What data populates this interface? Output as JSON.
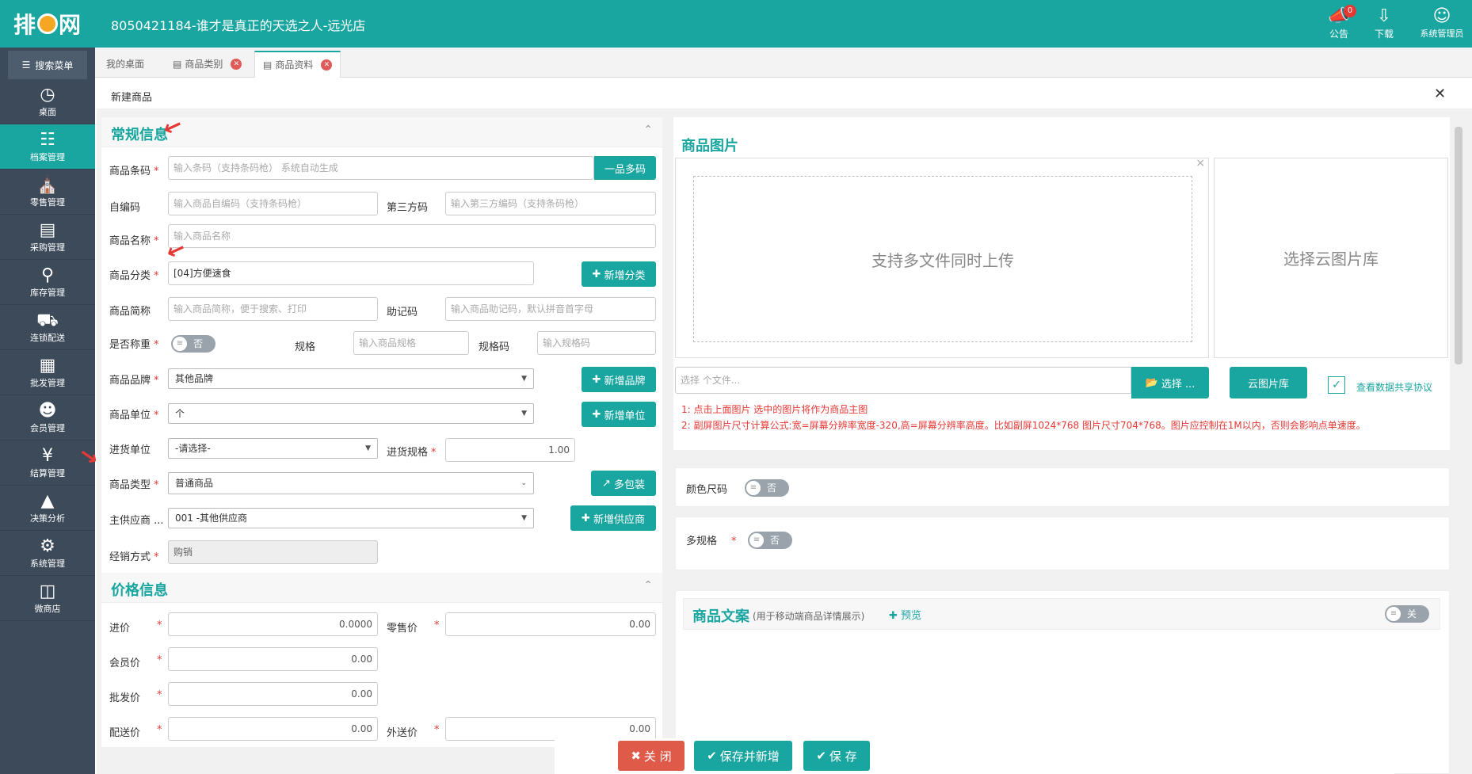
{
  "header": {
    "title": "8050421184-谁才是真正的天选之人-远光店",
    "logo": "排队网",
    "notice_label": "公告",
    "notice_count": "0",
    "download_label": "下载",
    "user_label": "系统管理员"
  },
  "sidebar": {
    "search": "搜索菜单",
    "items": [
      {
        "label": "桌面",
        "icon": "dashboard-icon"
      },
      {
        "label": "档案管理",
        "icon": "file-icon"
      },
      {
        "label": "零售管理",
        "icon": "store-icon"
      },
      {
        "label": "采购管理",
        "icon": "cart-icon"
      },
      {
        "label": "库存管理",
        "icon": "inventory-icon"
      },
      {
        "label": "连锁配送",
        "icon": "truck-icon"
      },
      {
        "label": "批发管理",
        "icon": "wholesale-icon"
      },
      {
        "label": "会员管理",
        "icon": "member-icon"
      },
      {
        "label": "结算管理",
        "icon": "settle-icon"
      },
      {
        "label": "决策分析",
        "icon": "chart-icon"
      },
      {
        "label": "系统管理",
        "icon": "gear-icon"
      },
      {
        "label": "微商店",
        "icon": "bag-icon"
      }
    ]
  },
  "tabs": [
    {
      "label": "我的桌面"
    },
    {
      "label": "商品类别"
    },
    {
      "label": "商品资料"
    }
  ],
  "dialog": {
    "title": "新建商品"
  },
  "general": {
    "title": "常规信息",
    "barcode_label": "商品条码",
    "barcode_ph": "输入条码（支持条码枪） 系统自动生成",
    "multi_btn": "一品多码",
    "selfcode_label": "自编码",
    "selfcode_ph": "输入商品自编码（支持条码枪）",
    "thirdcode_label": "第三方码",
    "thirdcode_ph": "输入第三方编码（支持条码枪）",
    "name_label": "商品名称",
    "name_ph": "输入商品名称",
    "category_label": "商品分类",
    "category_val": "[04]方便速食",
    "add_category": "新增分类",
    "short_label": "商品简称",
    "short_ph": "输入商品简称，便于搜索、打印",
    "mnemonic_label": "助记码",
    "mnemonic_ph": "输入商品助记码，默认拼音首字母",
    "weigh_label": "是否称重",
    "weigh_val": "否",
    "spec_label": "规格",
    "spec_ph": "输入商品规格",
    "speccode_label": "规格码",
    "speccode_ph": "输入规格码",
    "brand_label": "商品品牌",
    "brand_val": "其他品牌",
    "add_brand": "新增品牌",
    "unit_label": "商品单位",
    "unit_val": "个",
    "add_unit": "新增单位",
    "pur_unit_label": "进货单位",
    "pur_unit_val": "-请选择-",
    "pur_spec_label": "进货规格",
    "pur_spec_val": "1.00",
    "type_label": "商品类型",
    "type_val": "普通商品",
    "pack_btn": "多包装",
    "supplier_label": "主供应商",
    "supplier_val": "001 -其他供应商",
    "add_supplier": "新增供应商",
    "mode_label": "经销方式",
    "mode_val": "购销"
  },
  "price": {
    "title": "价格信息",
    "cost_label": "进价",
    "cost_val": "0.0000",
    "retail_label": "零售价",
    "retail_val": "0.00",
    "member_label": "会员价",
    "member_val": "0.00",
    "wholesale_label": "批发价",
    "wholesale_val": "0.00",
    "delivery_label": "配送价",
    "delivery_val": "0.00",
    "external_label": "外送价",
    "external_val": "0.00"
  },
  "images": {
    "title": "商品图片",
    "upload_hint": "支持多文件同时上传",
    "cloud_hint": "选择云图片库",
    "file_ph": "选择 个文件...",
    "select_btn": "选择 ...",
    "cloud_btn": "云图片库",
    "share_label": "查看数据共享协议",
    "note1": "1: 点击上面图片 选中的图片将作为商品主图",
    "note2": "2: 副屏图片尺寸计算公式:宽=屏幕分辨率宽度-320,高=屏幕分辨率高度。比如副屏1024*768 图片尺寸704*768。图片应控制在1M以内，否则会影响点单速度。"
  },
  "color_size": {
    "label": "颜色尺码",
    "val": "否"
  },
  "multi_spec": {
    "label": "多规格",
    "val": "否"
  },
  "copy": {
    "title": "商品文案",
    "sub": "(用于移动端商品详情展示)",
    "preview": "预览",
    "toggle": "关"
  },
  "footer": {
    "close": "关 闭",
    "save_new": "保存并新增",
    "save": "保 存"
  }
}
